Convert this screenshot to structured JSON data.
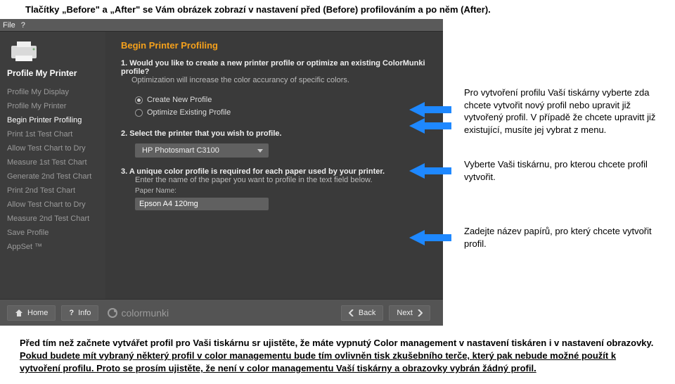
{
  "top_caption": "Tlačítky „Before\" a „After\" se Vám obrázek zobrazí v nastavení před (Before) profilováním a po něm (After).",
  "menu": {
    "file": "File",
    "help": "?"
  },
  "sidebar": {
    "head": "Profile My Printer",
    "items": [
      {
        "label": "Profile My Display"
      },
      {
        "label": "Profile My Printer"
      },
      {
        "label": "Begin Printer Profiling",
        "selected": true
      },
      {
        "label": "Print 1st Test Chart"
      },
      {
        "label": "Allow Test Chart to Dry"
      },
      {
        "label": "Measure 1st Test Chart"
      },
      {
        "label": "Generate 2nd Test Chart"
      },
      {
        "label": "Print 2nd Test Chart"
      },
      {
        "label": "Allow Test Chart to Dry"
      },
      {
        "label": "Measure 2nd Test Chart"
      },
      {
        "label": "Save Profile"
      },
      {
        "label": "AppSet ™"
      }
    ]
  },
  "main": {
    "title": "Begin Printer Profiling",
    "step1_a": "1.   Would you like to create a new printer profile or optimize an existing ColorMunki profile?",
    "step1_b": "Optimization will increase the color accurancy of specific colors.",
    "radio_new": "Create New Profile",
    "radio_opt": "Optimize Existing Profile",
    "step2": "2.   Select the printer that you wish to profile.",
    "printer_selected": "HP Photosmart C3100",
    "step3_a": "3.   A unique color profile is required for each paper used by your printer.",
    "step3_b": "Enter the name of the paper you want to profile in the text field below.",
    "paper_label": "Paper Name:",
    "paper_value": "Epson A4 120mg"
  },
  "footer": {
    "home": "Home",
    "info": "Info",
    "brand": "colormunki",
    "back": "Back",
    "next": "Next"
  },
  "annotations": {
    "a1": "Pro vytvoření profilu Vaší tiskárny vyberte zda chcete vytvořit nový profil nebo upravit již vytvořený profil. V případě že chcete upravitt již existující, musíte jej vybrat z menu.",
    "a2": "Vyberte Vaši tiskárnu, pro kterou chcete profil vytvořit.",
    "a3": "Zadejte název papírů, pro který chcete vytvořit profil."
  },
  "bottom": {
    "line1": "Před tím než začnete vytvářet profil pro Vaši tiskárnu sr ujistěte, že máte vypnutý Color management v nastavení tiskáren i v nastavení obrazovky.",
    "line2": "Pokud budete mít vybraný některý profil v color managementu bude tím ovlivněn tisk zkušebního terče, který pak nebude možné použít k vytvoření profilu. Proto se prosím ujistěte, že není v color managementu Vaší tiskárny a obrazovky vybrán žádný profil."
  }
}
